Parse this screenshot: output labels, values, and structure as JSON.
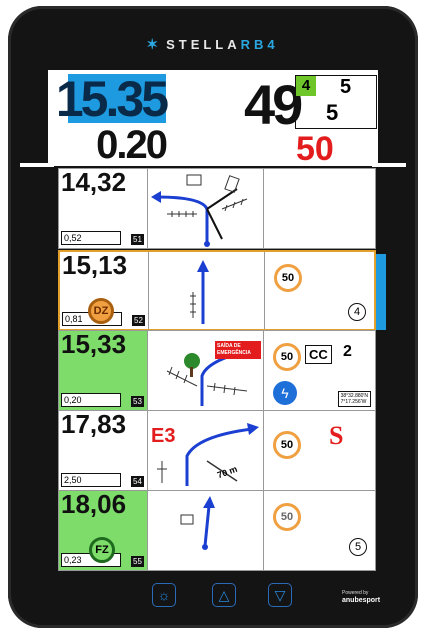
{
  "brand": {
    "name": "STELLA",
    "suffix": "RB4"
  },
  "header": {
    "speed": "15.35",
    "distance": "0.20",
    "center_value": "49",
    "box_green": "4",
    "box_top": "5",
    "box_bottom": "5",
    "red_value": "50"
  },
  "rows": [
    {
      "km": "14,32",
      "partial": "0,52",
      "num": "51"
    },
    {
      "km": "15,13",
      "partial": "0,81",
      "num": "52",
      "badge": "DZ",
      "sign": "50",
      "circle": "4"
    },
    {
      "km": "15,33",
      "partial": "0,20",
      "num": "53",
      "sign": "50",
      "cc": "CC",
      "cc_num": "2",
      "exit": "SAÍDA DE EMERGÊNCIA",
      "coords": "38°32.880'N\n7°17.256'W"
    },
    {
      "km": "17,83",
      "partial": "2,50",
      "num": "54",
      "e3": "E3",
      "dist": "70 m",
      "sign": "50"
    },
    {
      "km": "18,06",
      "partial": "0,23",
      "num": "55",
      "badge": "FZ",
      "sign": "50",
      "circle": "5"
    }
  ],
  "footer": {
    "powered": "Powered by",
    "company": "anubesport"
  },
  "colors": {
    "accent": "#1e9be0",
    "highlight": "#e3a02b",
    "green": "#7edc6a",
    "red": "#e31d1d"
  }
}
